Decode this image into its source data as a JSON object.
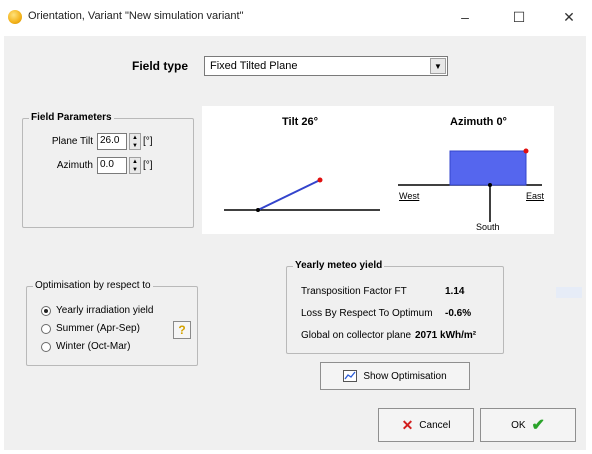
{
  "window": {
    "title": "Orientation, Variant \"New simulation variant\"",
    "minimize_icon": "minimize-icon",
    "maximize_icon": "maximize-icon",
    "close_icon": "close-icon",
    "min_glyph": "–",
    "max_glyph": "☐",
    "close_glyph": "✕"
  },
  "field_type": {
    "label": "Field type",
    "value": "Fixed Tilted Plane"
  },
  "field_parameters": {
    "title": "Field Parameters",
    "plane_tilt_label": "Plane Tilt",
    "plane_tilt_value": "26.0",
    "azimuth_label": "Azimuth",
    "azimuth_value": "0.0",
    "unit": "[°]"
  },
  "preview": {
    "tilt_label": "Tilt 26°",
    "azimuth_label": "Azimuth 0°",
    "west": "West",
    "east": "East",
    "south": "South"
  },
  "optimisation": {
    "title": "Optimisation by respect to",
    "options": [
      {
        "label": "Yearly irradiation yield",
        "checked": true
      },
      {
        "label": "Summer (Apr-Sep)",
        "checked": false
      },
      {
        "label": "Winter (Oct-Mar)",
        "checked": false
      }
    ],
    "help": "?"
  },
  "yearly_meteo": {
    "title": "Yearly meteo yield",
    "rows": [
      {
        "label": "Transposition Factor FT",
        "value": "1.14"
      },
      {
        "label": "Loss By Respect To Optimum",
        "value": "-0.6%"
      },
      {
        "label": "Global on collector plane",
        "value": "2071 kWh/m²"
      }
    ]
  },
  "buttons": {
    "show_optimisation": "Show Optimisation",
    "cancel": "Cancel",
    "ok": "OK"
  },
  "colors": {
    "preview_blue": "#5566ee",
    "preview_line": "#3344cc",
    "marker_red": "#e01010",
    "cancel_red": "#d21e1e",
    "ok_green": "#2aa32a"
  }
}
